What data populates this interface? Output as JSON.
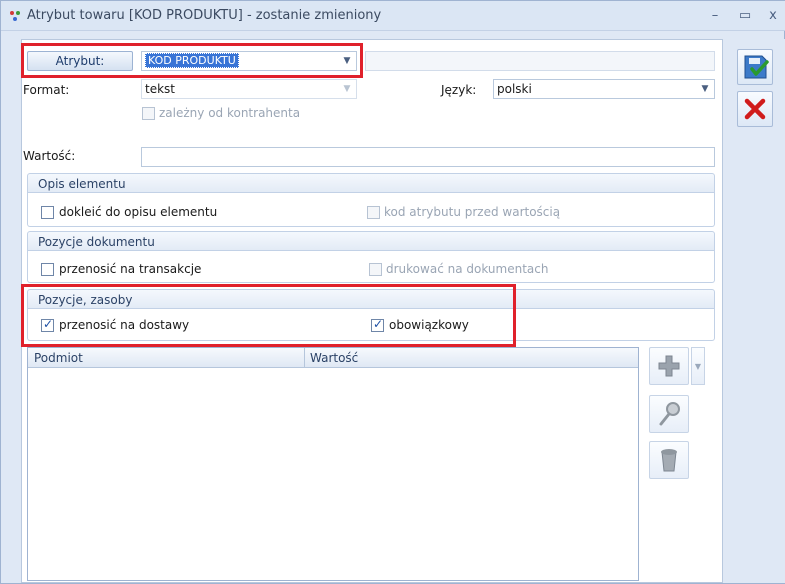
{
  "window": {
    "title": "Atrybut towaru [KOD PRODUKTU] - zostanie zmieniony",
    "minimize": "–",
    "maximize": "▭",
    "close": "x"
  },
  "form": {
    "attribute_button": "Atrybut:",
    "attribute_value": "KOD PRODUKTU",
    "format_label": "Format:",
    "format_value": "tekst",
    "language_label": "Język:",
    "language_value": "polski",
    "contractor_dependent": "zależny od kontrahenta",
    "value_label": "Wartość:"
  },
  "groups": [
    {
      "header": "Opis elementu",
      "options": [
        {
          "label": "dokleić do opisu elementu",
          "checked": false,
          "enabled": true
        },
        {
          "label": "kod atrybutu przed wartością",
          "checked": false,
          "enabled": false
        }
      ]
    },
    {
      "header": "Pozycje dokumentu",
      "options": [
        {
          "label": "przenosić na transakcje",
          "checked": false,
          "enabled": true
        },
        {
          "label": "drukować na dokumentach",
          "checked": false,
          "enabled": false
        }
      ]
    },
    {
      "header": "Pozycje, zasoby",
      "options": [
        {
          "label": "przenosić na dostawy",
          "checked": true,
          "enabled": true
        },
        {
          "label": "obowiązkowy",
          "checked": true,
          "enabled": true
        }
      ]
    }
  ],
  "grid": {
    "columns": [
      "Podmiot",
      "Wartość"
    ]
  },
  "icons": {
    "save": "save-icon",
    "cancel": "cancel-icon",
    "add": "plus-icon",
    "edit": "magnifier-icon",
    "delete": "trash-icon"
  },
  "colors": {
    "highlight": "#e0212b",
    "accent": "#3874d6"
  }
}
